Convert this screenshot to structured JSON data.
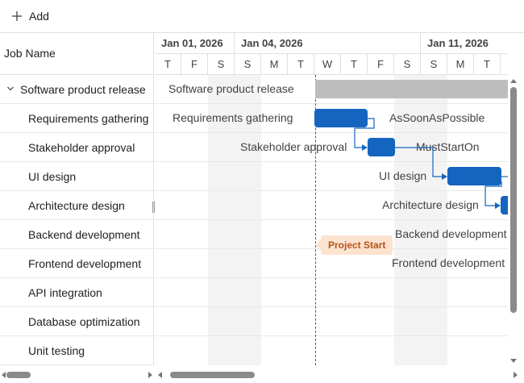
{
  "toolbar": {
    "add_label": "Add"
  },
  "grid": {
    "header": "Job Name",
    "rows": [
      {
        "name": "Software product release",
        "parent": true
      },
      {
        "name": "Requirements gathering"
      },
      {
        "name": "Stakeholder approval"
      },
      {
        "name": "UI design"
      },
      {
        "name": "Architecture design"
      },
      {
        "name": "Backend development"
      },
      {
        "name": "Frontend development"
      },
      {
        "name": "API integration"
      },
      {
        "name": "Database optimization"
      },
      {
        "name": "Unit testing"
      }
    ]
  },
  "timeline": {
    "weeks": [
      "Jan 01, 2026",
      "Jan 04, 2026",
      "Jan 11, 2026"
    ],
    "days": [
      "T",
      "F",
      "S",
      "S",
      "M",
      "T",
      "W",
      "T",
      "F",
      "S",
      "S",
      "M",
      "T"
    ]
  },
  "chart": {
    "labels": {
      "parent": "Software product release",
      "requirements": "Requirements gathering",
      "stakeholder": "Stakeholder approval",
      "ui": "UI design",
      "architecture": "Architecture design",
      "backend": "Backend development",
      "frontend": "Frontend development"
    },
    "constraints": {
      "requirements": "AsSoonAsPossible",
      "stakeholder": "MustStartOn"
    },
    "event_marker": "Project Start"
  },
  "colors": {
    "task_bar": "#1565c0",
    "parent_bar": "#bdbdbd",
    "weekend": "#f3f3f3",
    "event_bg": "#fce3d0",
    "event_text": "#b4531a"
  }
}
